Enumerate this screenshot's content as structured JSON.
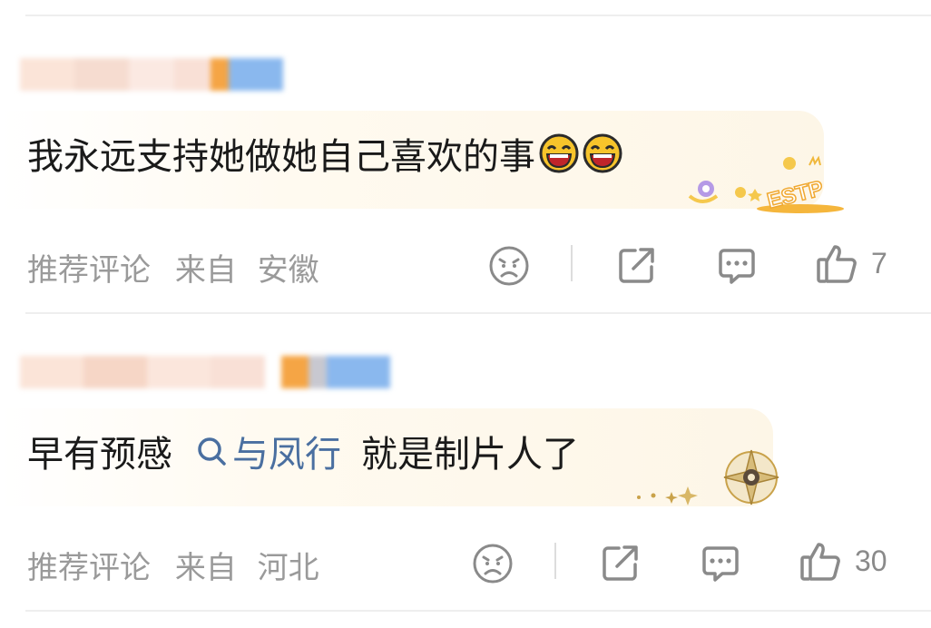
{
  "comments": [
    {
      "text": "我永远支持她做她自己喜欢的事",
      "emojis": [
        "laughing-emoji",
        "laughing-emoji"
      ],
      "badge": {
        "icon": "estp-badge",
        "label": "ESTP"
      },
      "tag": "推荐评论",
      "location_prefix": "来自",
      "location": "安徽",
      "likes": "7"
    },
    {
      "text_before": "早有预感",
      "topic": "与凤行",
      "text_after": "就是制片人了",
      "badge": {
        "icon": "compass-badge"
      },
      "tag": "推荐评论",
      "location_prefix": "来自",
      "location": "河北",
      "likes": "30"
    }
  ],
  "icons": {
    "dislike": "sad-face-icon",
    "share": "share-icon",
    "comment": "comment-icon",
    "like": "thumbs-up-icon",
    "topic_search": "search-icon"
  },
  "colors": {
    "text": "#1a1a1a",
    "meta": "#9a9a9a",
    "icon": "#8a8a8a",
    "topic": "#4a6fa0",
    "bubble": "#fdf6e7"
  }
}
